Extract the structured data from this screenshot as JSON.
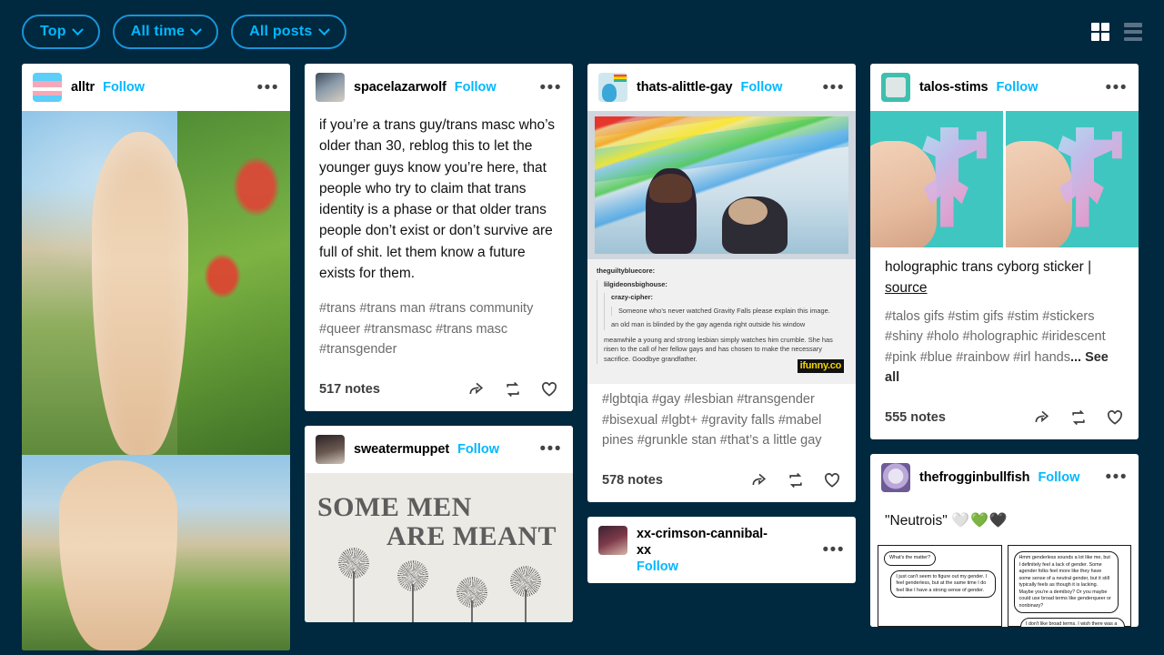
{
  "topbar": {
    "filters": [
      {
        "label": "Top",
        "icon": "chevron-down-icon"
      },
      {
        "label": "All time",
        "icon": "chevron-down-icon"
      },
      {
        "label": "All posts",
        "icon": "chevron-down-icon"
      }
    ],
    "view_grid": "grid-view-icon",
    "view_list": "list-view-icon",
    "accent": "#00b8ff",
    "background": "#00283f"
  },
  "actions": {
    "share": "share-icon",
    "reblog": "reblog-icon",
    "like": "heart-icon",
    "more": "•••"
  },
  "posts": {
    "alltr": {
      "username": "alltr",
      "follow": "Follow",
      "avatar": "trans-flag-avatar"
    },
    "spacelazarwolf": {
      "username": "spacelazarwolf",
      "follow": "Follow",
      "body": "if you’re a trans guy/trans masc who’s older than 30, reblog this to let the younger guys know you’re here, that people who try to claim that trans identity is a phase or that older trans people don’t exist or don’t survive are full of shit. let them know a future exists for them.",
      "tags": "#trans  #trans man  #trans community  #queer  #transmasc  #trans masc  #transgender",
      "notes": "517 notes"
    },
    "thats_alittle_gay": {
      "username": "thats-alittle-gay",
      "follow": "Follow",
      "watermark": "ifunny.co",
      "reblog_chain": [
        {
          "user": "theguiltybluecore:",
          "text": ""
        },
        {
          "user": "lilgideonsbighouse:",
          "text": ""
        },
        {
          "user": "crazy-cipher:",
          "text": "Someone who’s never watched Gravity Falls please explain this image."
        },
        {
          "user": "",
          "text": "an old man is blinded by the gay agenda right outside his window"
        },
        {
          "user": "",
          "text": "meanwhile a young and strong lesbian simply watches him crumble. She has risen to the call of her fellow gays and has chosen to make the necessary sacrifice. Goodbye grandfather."
        }
      ],
      "tags": "#lgbtqia  #gay  #lesbian  #transgender  #bisexual  #lgbt+  #gravity falls  #mabel pines  #grunkle stan  #that’s a little gay",
      "notes": "578 notes"
    },
    "sweatermuppet": {
      "username": "sweatermuppet",
      "follow": "Follow",
      "poster_line1": "SOME MEN",
      "poster_line2": "ARE MEANT"
    },
    "xx_crimson_cannibal_xx": {
      "username": "xx-crimson-cannibal-xx",
      "follow": "Follow"
    },
    "talos_stims": {
      "username": "talos-stims",
      "follow": "Follow",
      "caption": "holographic trans cyborg sticker | ",
      "caption_link": "source",
      "tags": "#talos gifs  #stim gifs  #stim  #stickers  #shiny  #holo  #holographic  #iridescent  #pink  #blue  #rainbow  #irl hands",
      "tags_more": "... See all",
      "notes": "555 notes"
    },
    "thefrogginbullfish": {
      "username": "thefrogginbullfish",
      "follow": "Follow",
      "caption": "\"Neutrois\"",
      "hearts": "🤍💚🖤",
      "comic": {
        "panel1_b1": "What's the matter?",
        "panel1_b2": "I just can't seem to figure out my gender. I feel genderless, but at the same time I do feel like I have a strong sense of gender.",
        "panel2_b1": "Hmm genderless sounds a lot like me, but I definitely feel a lack of gender. Some agender folks feel more like they have some sense of a neutral gender, but it still typically feels as though it is lacking. Maybe you're a demiboy? Or you maybe could use broad terms like genderqueer or nonbinary?",
        "panel2_b2": "I don't like broad terms. I wish there was a more precise"
      }
    }
  }
}
